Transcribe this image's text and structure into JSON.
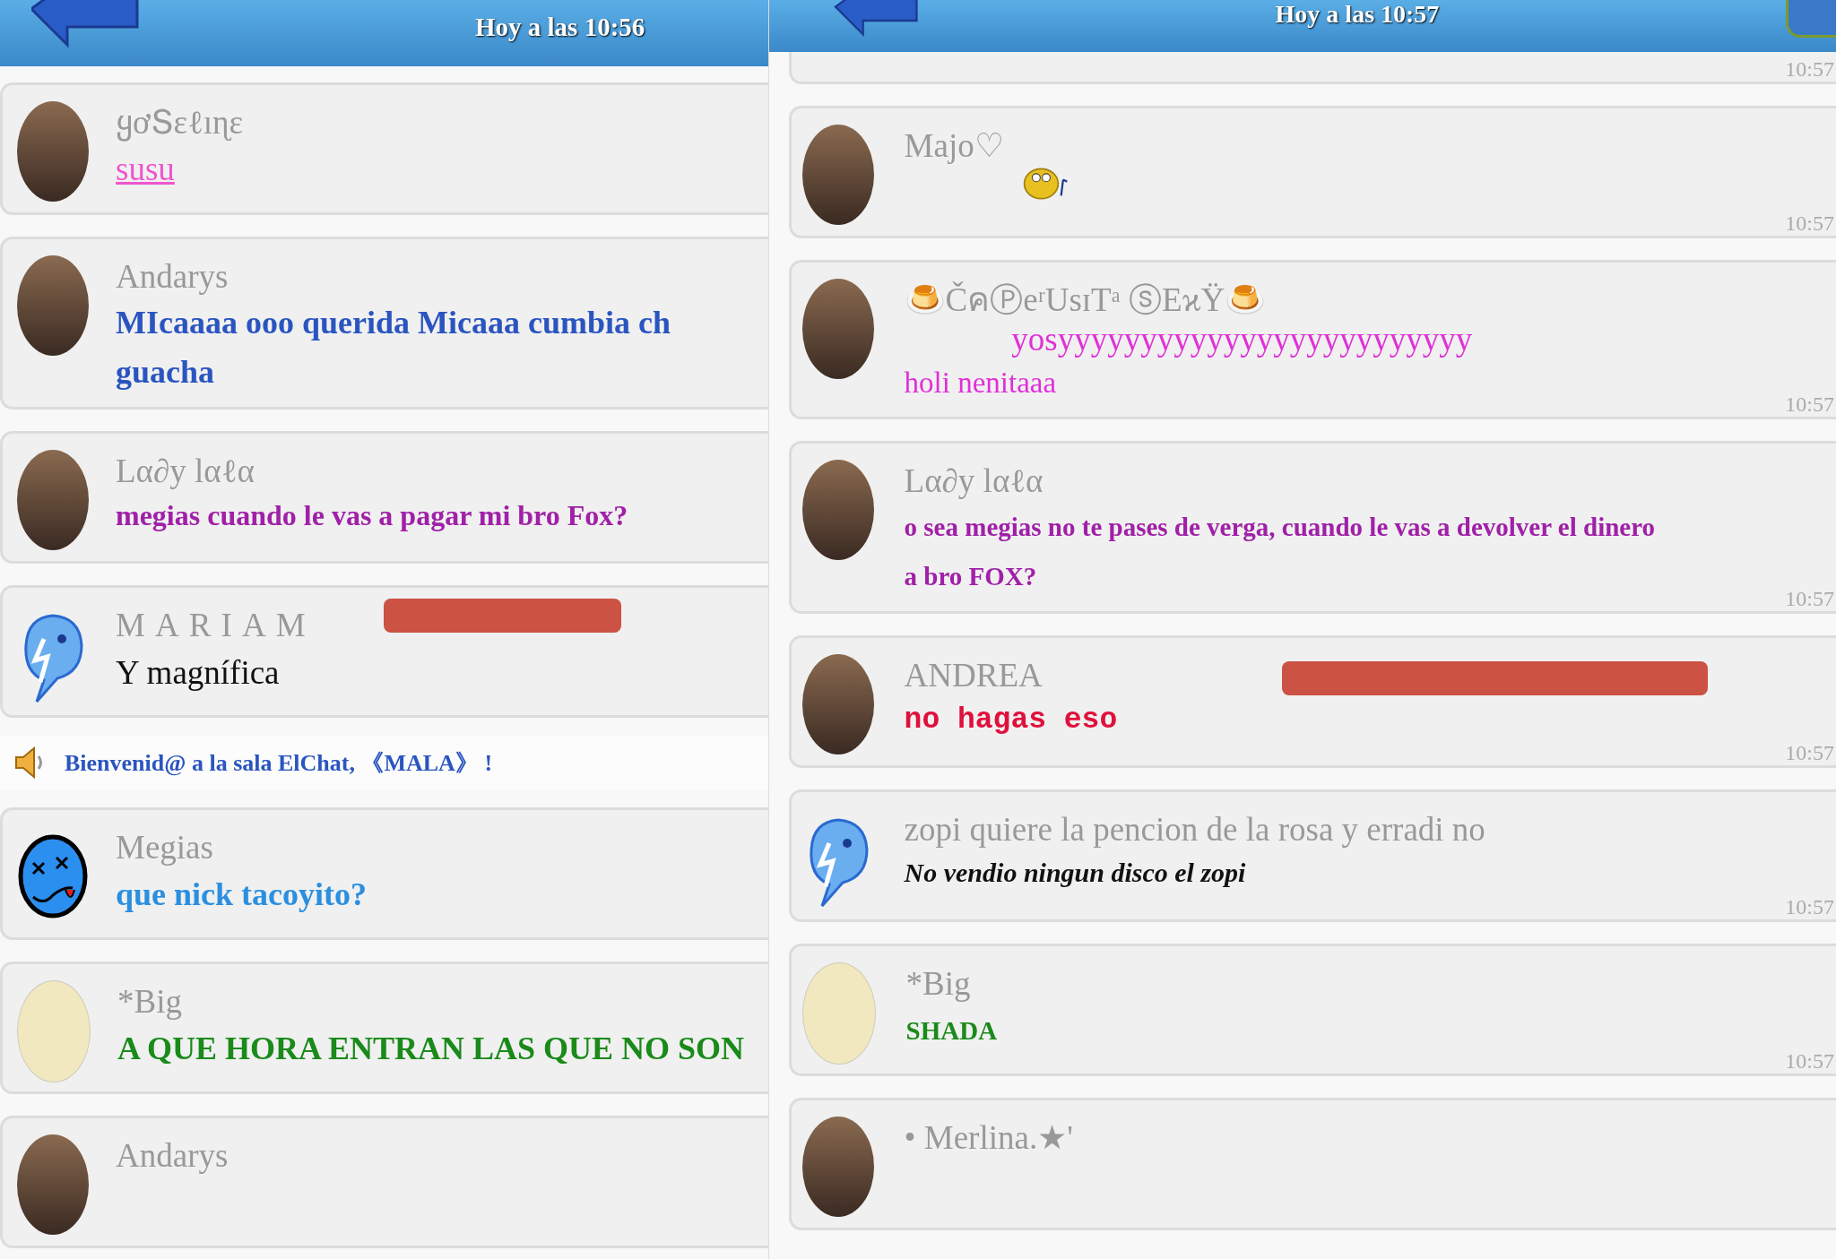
{
  "panels": [
    {
      "header": {
        "time": "Hoy a las 10:56"
      },
      "items": [
        {
          "kind": "message",
          "name": "ყơՏɛℓıɳɛ",
          "avatar": {
            "kind": "photo"
          },
          "message": {
            "kind": "underline",
            "color": "#ee55cc",
            "lines": [
              "susu"
            ]
          }
        },
        {
          "kind": "message",
          "name": "Andarys",
          "avatar": {
            "kind": "photo"
          },
          "message": {
            "kind": "bold-large",
            "color": "#2a55c0",
            "lines": [
              "MIcaaaa ooo querida Micaaa cumbia ch",
              "guacha"
            ]
          }
        },
        {
          "kind": "message",
          "name": "Lα∂y lαℓα",
          "avatar": {
            "kind": "photo"
          },
          "message": {
            "kind": "bold",
            "color": "#a020a8",
            "lines": [
              "megias cuando le vas a pagar mi bro Fox?"
            ]
          }
        },
        {
          "kind": "message",
          "name": "MARIAM",
          "spaced": true,
          "avatar": {
            "kind": "bird"
          },
          "message": {
            "kind": "plain",
            "color": "#111111",
            "lines": [
              "Y magnífica"
            ]
          }
        },
        {
          "kind": "notice",
          "text": "Bienvenid@ a la sala ElChat, 《MALA》 !"
        },
        {
          "kind": "message",
          "name": "Megias",
          "avatar": {
            "kind": "smiley"
          },
          "message": {
            "kind": "bold-large",
            "color": "#2b8fe0",
            "lines": [
              "que nick tacoyito?"
            ]
          }
        },
        {
          "kind": "message",
          "name": "*Big",
          "avatar": {
            "kind": "note"
          },
          "message": {
            "kind": "bold-large",
            "color": "#1a8a1a",
            "lines": [
              "A QUE HORA ENTRAN LAS QUE NO SON"
            ]
          }
        },
        {
          "kind": "message",
          "name": "Andarys",
          "avatar": {
            "kind": "photo"
          }
        }
      ]
    },
    {
      "header": {
        "time": "Hoy a las 10:57"
      },
      "items": [
        {
          "kind": "partial",
          "time": "10:57"
        },
        {
          "kind": "message",
          "name": "Majo♡",
          "avatar": {
            "kind": "photo"
          },
          "message": {
            "kind": "emoji",
            "color": "#e8c020"
          },
          "time": "10:57"
        },
        {
          "kind": "message",
          "name": "🍮ČคⓅeʳUsɪTᵃ ⓢEϰŸ🍮",
          "avatar": {
            "kind": "photo"
          },
          "message": {
            "kind": "plain",
            "color": "#e030d8",
            "aside": "yosyyyyyyyyyyyyyyyyyyyyyyyyy",
            "lines": [
              "holi nenitaaa"
            ]
          },
          "time": "10:57"
        },
        {
          "kind": "message",
          "name": "Lα∂y lαℓα",
          "avatar": {
            "kind": "photo"
          },
          "message": {
            "kind": "bold",
            "color": "#a020a8",
            "lines": [
              "o sea megias no te pases de verga, cuando le vas a devolver el dinero",
              "a bro FOX?"
            ]
          },
          "time": "10:57"
        },
        {
          "kind": "message",
          "name": "ANDREA",
          "avatar": {
            "kind": "photo"
          },
          "message": {
            "kind": "mono",
            "color": "#e0103c",
            "lines": [
              "no  hagas  eso"
            ]
          },
          "time": "10:57"
        },
        {
          "kind": "message",
          "name": "zopi quiere la pencion de la rosa y erradi no",
          "avatar": {
            "kind": "bird"
          },
          "message": {
            "kind": "italic-bold",
            "color": "#111111",
            "lines": [
              "No vendio ningun disco el zopi"
            ]
          },
          "time": "10:57"
        },
        {
          "kind": "message",
          "name": "*Big",
          "avatar": {
            "kind": "note"
          },
          "message": {
            "kind": "bold",
            "color": "#1a8a1a",
            "lines": [
              "SHADA"
            ]
          },
          "time": "10:57"
        },
        {
          "kind": "message",
          "name": "• Merlina.★'",
          "avatar": {
            "kind": "photo"
          }
        }
      ]
    }
  ]
}
